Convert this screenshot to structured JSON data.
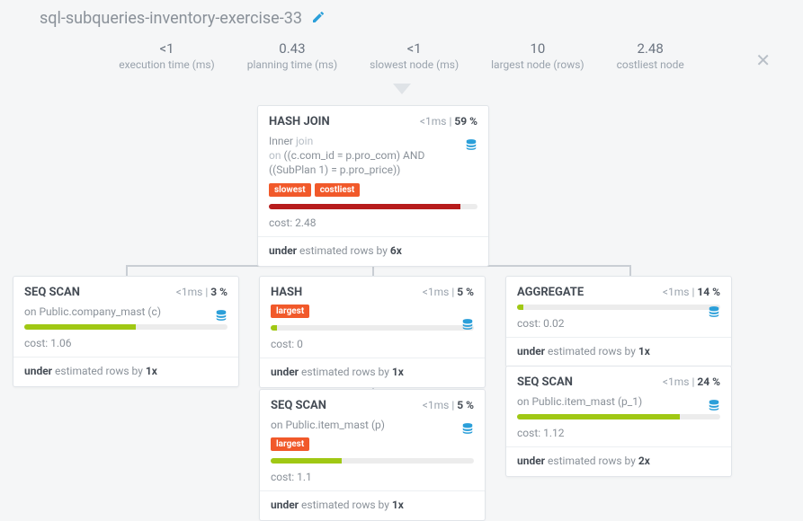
{
  "title": "sql-subqueries-inventory-exercise-33",
  "stats": {
    "exec": {
      "val": "<1",
      "lbl": "execution time (ms)"
    },
    "plan": {
      "val": "0.43",
      "lbl": "planning time (ms)"
    },
    "slow": {
      "val": "<1",
      "lbl": "slowest node (ms)"
    },
    "large": {
      "val": "10",
      "lbl": "largest node (rows)"
    },
    "cost": {
      "val": "2.48",
      "lbl": "costliest node"
    }
  },
  "nodes": {
    "hashjoin": {
      "title": "HASH JOIN",
      "time": "<1ms",
      "pct": "59 %",
      "desc_pre": "Inner ",
      "desc_kw1": "join",
      "desc_mid": "\non ",
      "desc_cond": "((c.com_id = p.pro_com) AND ((SubPlan 1) = p.pro_price))",
      "badges": [
        "slowest",
        "costliest"
      ],
      "bar_color": "#b71c1c",
      "bar_pct": 92,
      "cost": "cost: 2.48",
      "under_pre": "under",
      "under_mid": " estimated rows by ",
      "under_x": "6x"
    },
    "seq1": {
      "title": "SEQ SCAN",
      "time": "<1ms",
      "pct": "3 %",
      "on": "on Public.company_mast (c)",
      "bar_color": "#a0c814",
      "bar_pct": 55,
      "cost": "cost: 1.06",
      "under_pre": "under",
      "under_mid": " estimated rows by ",
      "under_x": "1x"
    },
    "hash": {
      "title": "HASH",
      "time": "<1ms",
      "pct": "5 %",
      "badges": [
        "largest"
      ],
      "bar_color": "#a0c814",
      "bar_pct": 3,
      "cost": "cost: 0",
      "under_pre": "under",
      "under_mid": " estimated rows by ",
      "under_x": "1x"
    },
    "agg": {
      "title": "AGGREGATE",
      "time": "<1ms",
      "pct": "14 %",
      "bar_color": "#a0c814",
      "bar_pct": 3,
      "cost": "cost: 0.02",
      "under_pre": "under",
      "under_mid": " estimated rows by ",
      "under_x": "1x"
    },
    "seq2": {
      "title": "SEQ SCAN",
      "time": "<1ms",
      "pct": "5 %",
      "on": "on Public.item_mast (p)",
      "badges": [
        "largest"
      ],
      "bar_color": "#a0c814",
      "bar_pct": 35,
      "cost": "cost: 1.1",
      "under_pre": "under",
      "under_mid": " estimated rows by ",
      "under_x": "1x"
    },
    "seq3": {
      "title": "SEQ SCAN",
      "time": "<1ms",
      "pct": "24 %",
      "on": "on Public.item_mast (p_1)",
      "bar_color": "#a0c814",
      "bar_pct": 80,
      "cost": "cost: 1.12",
      "under_pre": "under",
      "under_mid": " estimated rows by ",
      "under_x": "2x"
    }
  }
}
